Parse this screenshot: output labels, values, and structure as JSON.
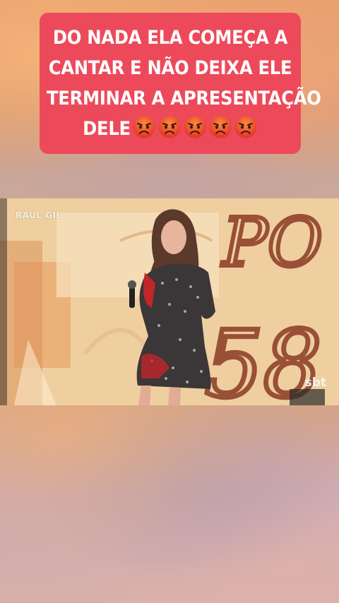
{
  "caption": {
    "lines": [
      "DO NADA ELA COMEÇA A",
      "CANTAR E NÃO DEIXA ELE",
      "TERMINAR A APRESENTAÇÃO",
      "DELE"
    ],
    "emoji_name": "angry-face",
    "emoji_count": 5,
    "background_color": "#ec4a5b"
  },
  "video": {
    "watermark_left": "RAUL GIL",
    "watermark_right": "sbt"
  }
}
